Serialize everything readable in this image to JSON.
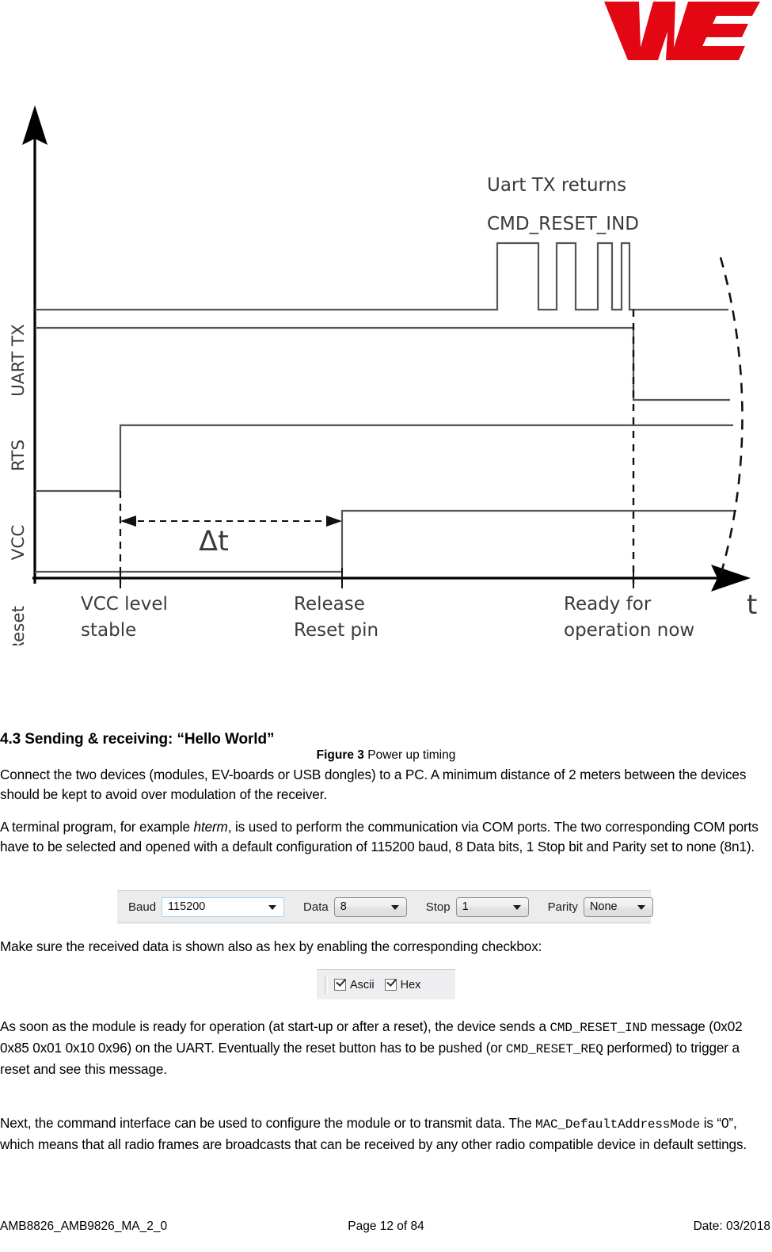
{
  "header": {
    "logo_alt": "WE Würth Elektronik logo",
    "logo_color": "#e30613"
  },
  "figure": {
    "caption_label": "Figure 3",
    "caption_text": "Power up timing",
    "diagram": {
      "y_axis_signals": [
        "UART TX",
        "RTS",
        "VCC",
        "Reset"
      ],
      "x_axis_label": "t",
      "annotations": [
        "Uart TX returns",
        "CMD_RESET_IND",
        "Δt",
        "VCC level\nstable",
        "Release\nReset pin",
        "Ready for\noperation now"
      ],
      "annotation_uart_returns": "Uart TX returns",
      "annotation_cmd_reset_ind": "CMD_RESET_IND",
      "annotation_delta_t": "Δt",
      "tick_vcc_stable_line1": "VCC level",
      "tick_vcc_stable_line2": "stable",
      "tick_release_reset_line1": "Release",
      "tick_release_reset_line2": "Reset pin",
      "tick_ready_line1": "Ready for",
      "tick_ready_line2": "operation now"
    }
  },
  "section": {
    "heading": "4.3 Sending & receiving: “Hello World”",
    "paragraph_1": "Connect the two devices (modules, EV-boards or USB dongles) to a PC. A minimum distance of 2 meters between the devices should be kept to avoid over modulation of the receiver.",
    "paragraph_2_part1": "A terminal program, for example ",
    "paragraph_2_italic": "hterm",
    "paragraph_2_part2": ", is used to perform the communication via COM ports. The two corresponding COM ports have to be selected and opened with a default configuration of 115200 baud, 8 Data bits, 1 Stop bit and Parity set to none (8n1).",
    "paragraph_3": "Make sure the received data is shown also as hex by enabling the corresponding checkbox:",
    "paragraph_4_part1": "As soon as the module is ready for operation (at start-up or after a reset), the device sends a ",
    "paragraph_4_mono1": "CMD_RESET_IND",
    "paragraph_4_part2": " message (0x02 0x85 0x01 0x10 0x96) on the UART. Eventually the reset button has to be pushed (or ",
    "paragraph_4_mono2": "CMD_RESET_REQ",
    "paragraph_4_part3": " performed) to trigger a reset and see this message.",
    "paragraph_5_part1": "Next, the command interface can be used to configure the module or to transmit data. The ",
    "paragraph_5_mono1": "MAC_DefaultAddressMode",
    "paragraph_5_part2": " is “0”, which means that all radio frames are broadcasts that can be received by any other radio compatible device in default settings."
  },
  "serial_settings": {
    "baud": {
      "label": "Baud",
      "value": "115200"
    },
    "data": {
      "label": "Data",
      "value": "8"
    },
    "stop": {
      "label": "Stop",
      "value": "1"
    },
    "parity": {
      "label": "Parity",
      "value": "None"
    }
  },
  "display_format": {
    "ascii": {
      "label": "Ascii",
      "checked": true
    },
    "hex": {
      "label": "Hex",
      "checked": true
    }
  },
  "footer": {
    "doc_id": "AMB8826_AMB9826_MA_2_0",
    "page": "Page 12 of 84",
    "date": "Date: 03/2018"
  }
}
